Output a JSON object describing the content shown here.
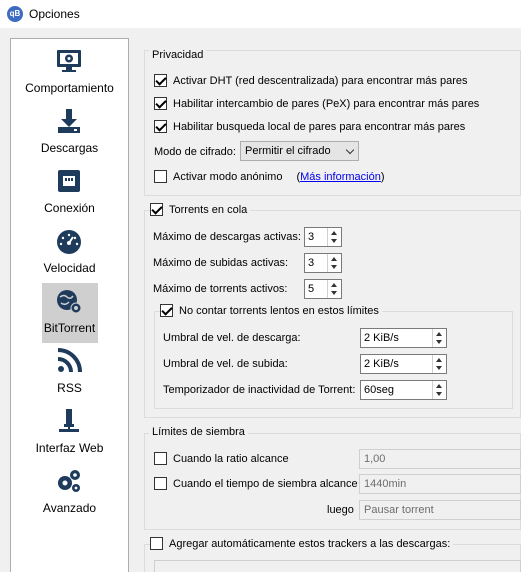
{
  "window": {
    "title": "Opciones",
    "app_icon": "qB"
  },
  "sidebar": {
    "items": [
      {
        "label": "Comportamiento",
        "icon": "monitor-gear-icon"
      },
      {
        "label": "Descargas",
        "icon": "download-icon"
      },
      {
        "label": "Conexión",
        "icon": "ethernet-icon"
      },
      {
        "label": "Velocidad",
        "icon": "speedometer-icon"
      },
      {
        "label": "BitTorrent",
        "icon": "globe-gear-icon",
        "selected": true
      },
      {
        "label": "RSS",
        "icon": "rss-icon"
      },
      {
        "label": "Interfaz Web",
        "icon": "usb-plug-icon"
      },
      {
        "label": "Avanzado",
        "icon": "gears-icon"
      }
    ]
  },
  "privacy": {
    "title": "Privacidad",
    "dht": "Activar DHT (red descentralizada) para encontrar más pares",
    "pex": "Habilitar intercambio de pares (PeX) para encontrar más pares",
    "lsd": "Habilitar busqueda local de pares para encontrar más pares",
    "encryption_label": "Modo de cifrado:",
    "encryption_value": "Permitir el cifrado",
    "anon_label": "Activar modo anónimo",
    "more_info": "Más información",
    "paren_open": "(",
    "paren_close": ")"
  },
  "queue": {
    "title": "Torrents en cola",
    "max_downloads_label": "Máximo de descargas activas:",
    "max_downloads": "3",
    "max_uploads_label": "Máximo de subidas activas:",
    "max_uploads": "3",
    "max_torrents_label": "Máximo de torrents activos:",
    "max_torrents": "5",
    "slow_label": "No contar torrents lentos en estos límites",
    "dl_threshold_label": "Umbral de vel. de descarga:",
    "dl_threshold": "2 KiB/s",
    "ul_threshold_label": "Umbral de vel. de subida:",
    "ul_threshold": "2 KiB/s",
    "timer_label": "Temporizador de inactividad de Torrent:",
    "timer": "60seg"
  },
  "seeding": {
    "title": "Límites de siembra",
    "ratio_label": "Cuando la ratio alcance",
    "ratio_value": "1,00",
    "time_label": "Cuando el tiempo de siembra alcance",
    "time_value": "1440min",
    "then_label": "luego",
    "then_value": "Pausar torrent"
  },
  "trackers": {
    "label": "Agregar automáticamente estos trackers a las descargas:"
  }
}
